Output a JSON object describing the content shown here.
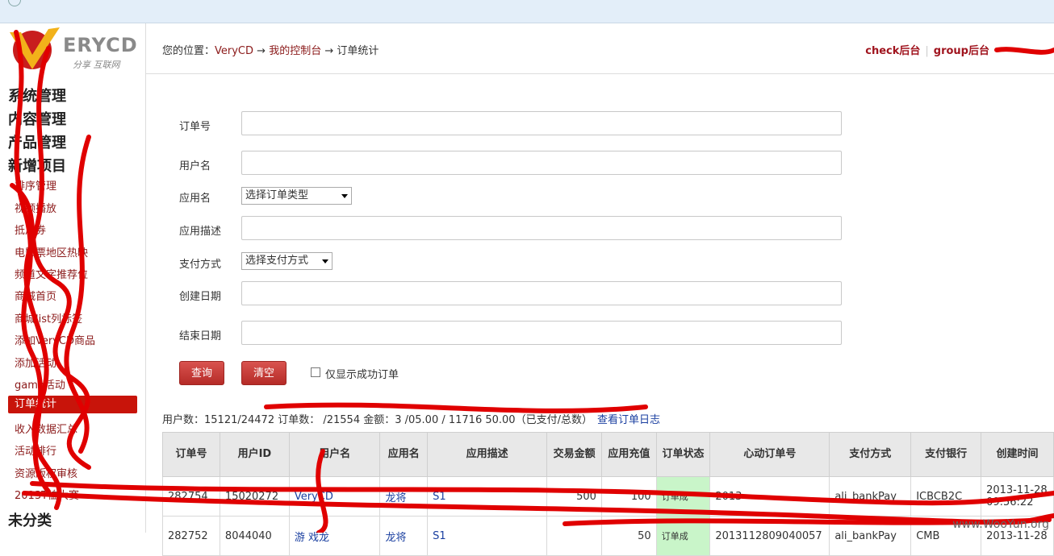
{
  "sidebar": {
    "logo_brand": "ERYCD",
    "logo_tag": "分享 互联网",
    "sections": [
      "系统管理",
      "内容管理",
      "产品管理",
      "新增项目"
    ],
    "items": [
      "排序管理",
      "视频播放",
      "抵用券",
      "电影票地区热映",
      "频道文字推荐位",
      "商城首页",
      "商城list列标签",
      "添加VeryCD商品",
      "添加活动",
      "game活动",
      "订单统计",
      "收入数据汇总",
      "活动排行",
      "资源版权审核",
      "2013T恤大赛"
    ],
    "active_item": "订单统计",
    "footer_section": "未分类"
  },
  "header": {
    "crumb_prefix": "您的位置：",
    "crumb_1": "VeryCD",
    "crumb_arrow_1": " → ",
    "crumb_2": "我的控制台",
    "crumb_arrow_2": " → ",
    "crumb_3": "订单统计",
    "link_check": "check后台",
    "link_group": "group后台"
  },
  "form": {
    "order_no_label": "订单号",
    "username_label": "用户名",
    "app_label": "应用名",
    "app_select": "选择订单类型",
    "app_desc_label": "应用描述",
    "pay_label": "支付方式",
    "pay_select": "选择支付方式",
    "created_label": "创建日期",
    "end_label": "结束日期",
    "query_button": "查询",
    "clear_button": "清空",
    "success_only_label": "仅显示成功订单"
  },
  "summary": {
    "text": "用户数：15121/24472 订单数：   /21554 金额：3      /05.00 / 11716     50.00（已支付/总数）",
    "log_link": "查看订单日志"
  },
  "table": {
    "headers": [
      "订单号",
      "用户ID",
      "用户名",
      "应用名",
      "应用描述",
      "交易金额",
      "应用充值",
      "订单状态",
      "心动订单号",
      "支付方式",
      "支付银行",
      "创建时间"
    ],
    "rows": [
      [
        "282754",
        "15020272",
        "VeryCD",
        "龙将",
        "S1",
        "500",
        "100",
        "订单成",
        "2013",
        "ali_bankPay",
        "ICBCB2C",
        "2013-11-28 09:56:22"
      ],
      [
        "282752",
        "8044040",
        "游 戏龙",
        "龙将",
        "S1",
        "",
        "50",
        "订单成",
        "2013112809040057",
        "ali_bankPay",
        "CMB",
        "2013-11-28"
      ]
    ]
  },
  "watermark": "www.WooYun.org"
}
